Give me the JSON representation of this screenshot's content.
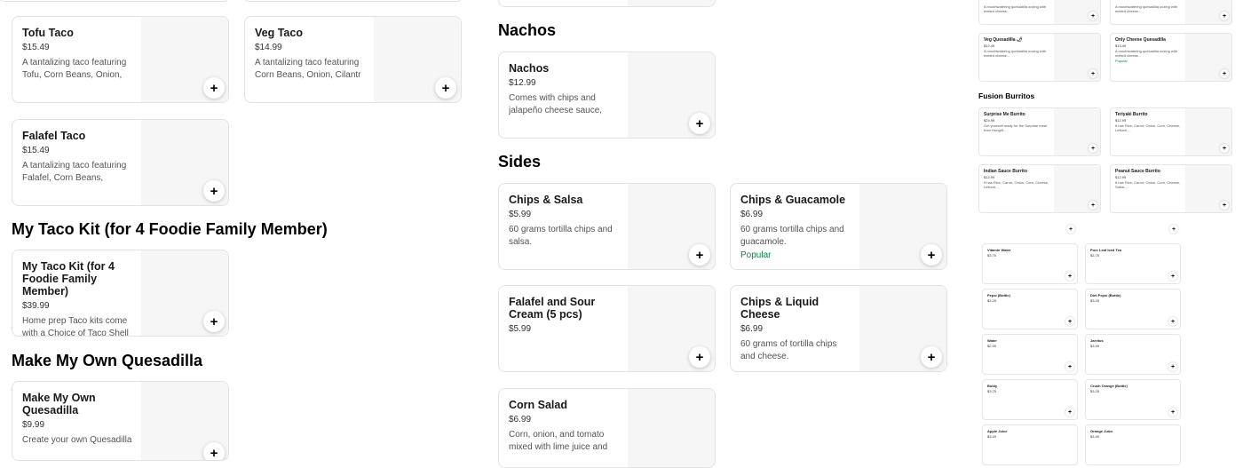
{
  "left": {
    "tacos": [
      {
        "name": "Tofu Taco",
        "price": "$15.49",
        "desc": "A tantalizing taco featuring Tofu, Corn Beans, Onion,"
      },
      {
        "name": "Veg Taco",
        "price": "$14.99",
        "desc": "A tantalizing taco featuring Corn Beans, Onion, Cilantr"
      },
      {
        "name": "Falafel Taco",
        "price": "$15.49",
        "desc": "A tantalizing taco featuring Falafel, Corn Beans, Onion,"
      }
    ],
    "kit_heading": "My Taco Kit (for 4 Foodie Family Member)",
    "kit": {
      "name": "My Taco Kit (for 4 Foodie Family Member)",
      "price": "$39.99",
      "desc": "Home prep Taco kits come with a Choice of Taco Shell"
    },
    "quesadilla_heading": "Make My Own Quesadilla",
    "quesadilla": {
      "name": "Make My Own Quesadilla",
      "price": "$9.99",
      "desc": "Create your own Quesadilla"
    }
  },
  "middle": {
    "nachos_heading": "Nachos",
    "nachos": {
      "name": "Nachos",
      "price": "$12.99",
      "desc": "Comes with chips and jalapeño cheese sauce,"
    },
    "sides_heading": "Sides",
    "sides": [
      {
        "name": "Chips & Salsa",
        "price": "$5.99",
        "desc": "60 grams tortilla chips and salsa.",
        "popular": ""
      },
      {
        "name": "Chips & Guacamole",
        "price": "$6.99",
        "desc": "60 grams tortilla chips and guacamole.",
        "popular": "Popular"
      },
      {
        "name": "Falafel and Sour Cream (5 pcs)",
        "price": "$5.99",
        "desc": "",
        "popular": ""
      },
      {
        "name": "Chips & Liquid Cheese",
        "price": "$6.99",
        "desc": "60 grams of tortilla chips and cheese.",
        "popular": ""
      },
      {
        "name": "Corn Salad",
        "price": "$6.99",
        "desc": "Corn, onion, and tomato mixed with lime juice and",
        "popular": ""
      }
    ]
  },
  "right": {
    "top_descs": [
      "A mouthwatering quesadilla oozing with melted cheese...",
      "A mouthwatering quesadilla oozing with melted cheese..."
    ],
    "quesadillas": [
      {
        "name": "Veg Quesadilla 🌶",
        "price": "$12.49",
        "desc": "A mouthwatering quesadilla oozing with melted cheese...",
        "popular": ""
      },
      {
        "name": "Only Cheese Quesadilla",
        "price": "$13.49",
        "desc": "A mouthwatering quesadilla oozing with melted cheese...",
        "popular": "Popular"
      }
    ],
    "burritos_heading": "Fusion Burritos",
    "burritos": [
      {
        "name": "Surprise Me Burrito",
        "price": "$24.99",
        "desc": "Get yourself ready for the Surprise meal from Hungrit..."
      },
      {
        "name": "Teriyaki Burrito",
        "price": "$12.99",
        "desc": "It has Rice, Carrot, Onion, Corn, Cheese, Lettuce,..."
      },
      {
        "name": "Indian Sauce Burrito",
        "price": "$12.99",
        "desc": "It has Rice, Carrot, Onion, Corn, Cheese, Lettuce,..."
      },
      {
        "name": "Peanut Sauce Burrito",
        "price": "$12.99",
        "desc": "It has Rice, Carrot, Onion, Corn, Cheese, Salsa,..."
      }
    ],
    "beverages": [
      {
        "name": "Vitamin Water",
        "price": "$3.75"
      },
      {
        "name": "Pure Leaf Iced Tea",
        "price": "$3.75"
      },
      {
        "name": "Pepsi (Bottle)",
        "price": "$3.25"
      },
      {
        "name": "Diet Pepsi (Bottle)",
        "price": "$3.25"
      },
      {
        "name": "Water",
        "price": "$2.99"
      },
      {
        "name": "Jarritos",
        "price": "$3.99"
      },
      {
        "name": "Bubly",
        "price": "$3.75"
      },
      {
        "name": "Crush Orange (Bottle)",
        "price": "$3.25"
      },
      {
        "name": "Apple Juice",
        "price": "$3.49"
      },
      {
        "name": "Orange Juice",
        "price": "$3.49"
      }
    ]
  },
  "icons": {
    "add": "+"
  }
}
